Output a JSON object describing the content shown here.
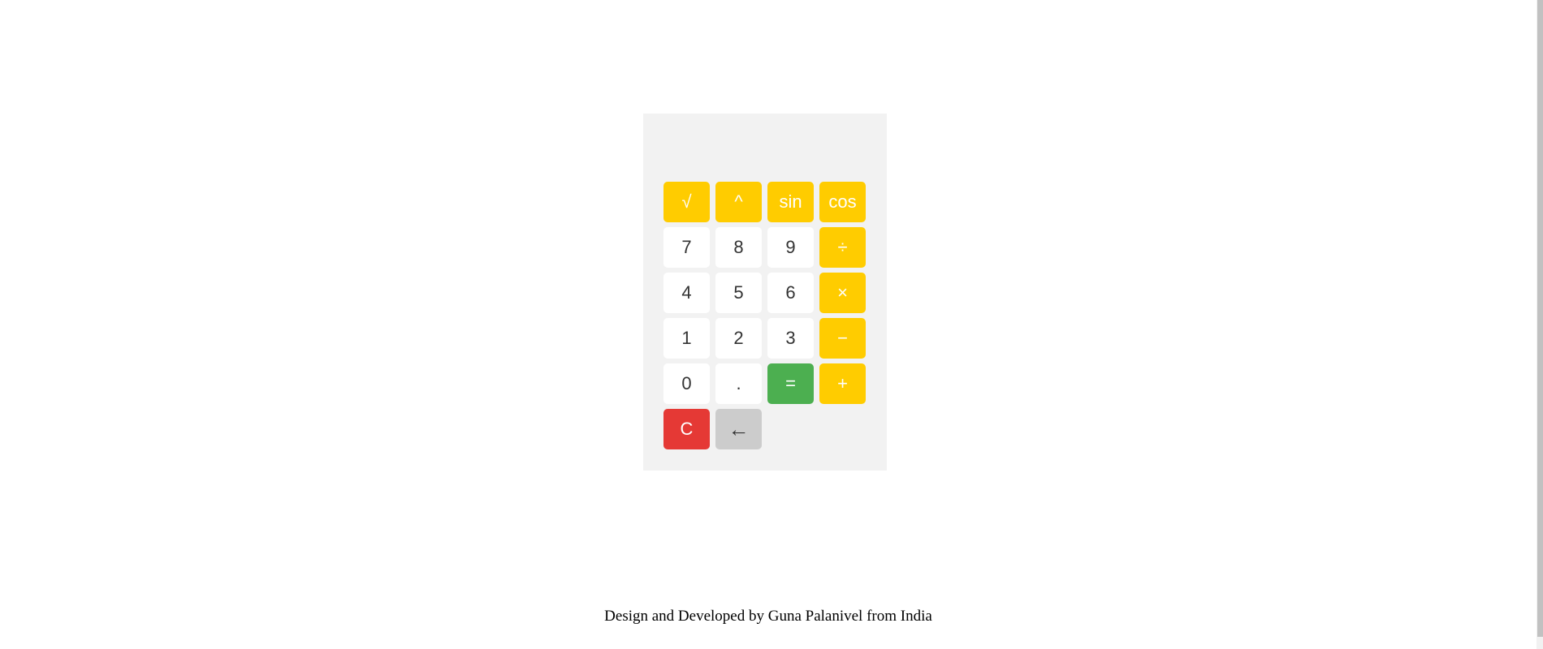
{
  "calculator": {
    "rows": [
      [
        {
          "label": "√",
          "type": "op",
          "name": "sqrt"
        },
        {
          "label": "^",
          "type": "op",
          "name": "power"
        },
        {
          "label": "sin",
          "type": "op",
          "name": "sin"
        },
        {
          "label": "cos",
          "type": "op",
          "name": "cos"
        }
      ],
      [
        {
          "label": "7",
          "type": "num",
          "name": "7"
        },
        {
          "label": "8",
          "type": "num",
          "name": "8"
        },
        {
          "label": "9",
          "type": "num",
          "name": "9"
        },
        {
          "label": "÷",
          "type": "op",
          "name": "divide"
        }
      ],
      [
        {
          "label": "4",
          "type": "num",
          "name": "4"
        },
        {
          "label": "5",
          "type": "num",
          "name": "5"
        },
        {
          "label": "6",
          "type": "num",
          "name": "6"
        },
        {
          "label": "×",
          "type": "op",
          "name": "multiply"
        }
      ],
      [
        {
          "label": "1",
          "type": "num",
          "name": "1"
        },
        {
          "label": "2",
          "type": "num",
          "name": "2"
        },
        {
          "label": "3",
          "type": "num",
          "name": "3"
        },
        {
          "label": "−",
          "type": "op",
          "name": "minus"
        }
      ],
      [
        {
          "label": "0",
          "type": "num",
          "name": "0"
        },
        {
          "label": ".",
          "type": "num",
          "name": "decimal"
        },
        {
          "label": "=",
          "type": "eq",
          "name": "equals"
        },
        {
          "label": "+",
          "type": "op",
          "name": "plus"
        }
      ],
      [
        {
          "label": "C",
          "type": "clr",
          "name": "clear"
        },
        {
          "label": "←",
          "type": "back",
          "name": "backspace"
        }
      ]
    ],
    "colors": {
      "operator": "#ffcc00",
      "equals": "#4caf50",
      "clear": "#e53935",
      "backspace": "#cccccc",
      "panel": "#f2f2f2"
    }
  },
  "footer": {
    "text": "Design and Developed by Guna Palanivel from India"
  }
}
